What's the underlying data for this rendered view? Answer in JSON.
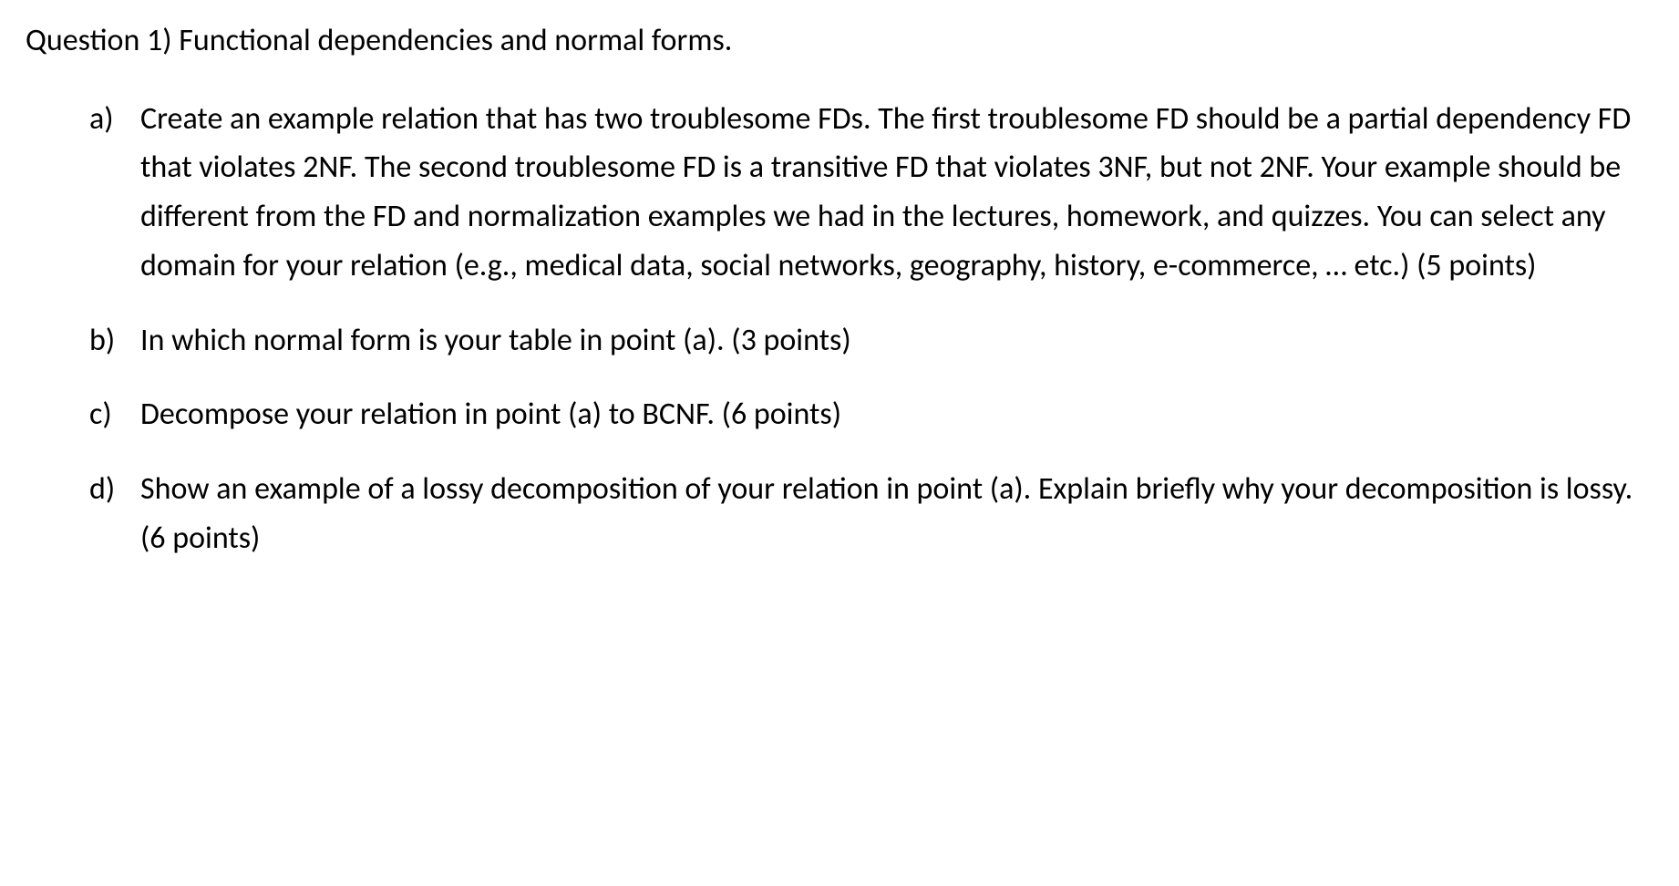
{
  "question": {
    "title": "Question 1) Functional dependencies and normal forms.",
    "parts": [
      {
        "marker": "a)",
        "text": "Create an example relation that has two troublesome FDs. The first troublesome FD should be a partial dependency FD that violates 2NF. The second troublesome FD is a transitive FD that violates 3NF, but not 2NF. Your example should be different from the FD and normalization examples we had in the lectures, homework, and quizzes. You can select any domain for your relation (e.g., medical data, social networks, geography, history, e-commerce, … etc.)  (5 points)"
      },
      {
        "marker": "b)",
        "text": "In which normal form is your table in point (a). (3 points)"
      },
      {
        "marker": "c)",
        "text": "Decompose your relation in point (a) to BCNF. (6 points)"
      },
      {
        "marker": "d)",
        "text": "Show an example of a lossy decomposition of your relation in point (a). Explain briefly why your decomposition is lossy. (6 points)"
      }
    ]
  }
}
